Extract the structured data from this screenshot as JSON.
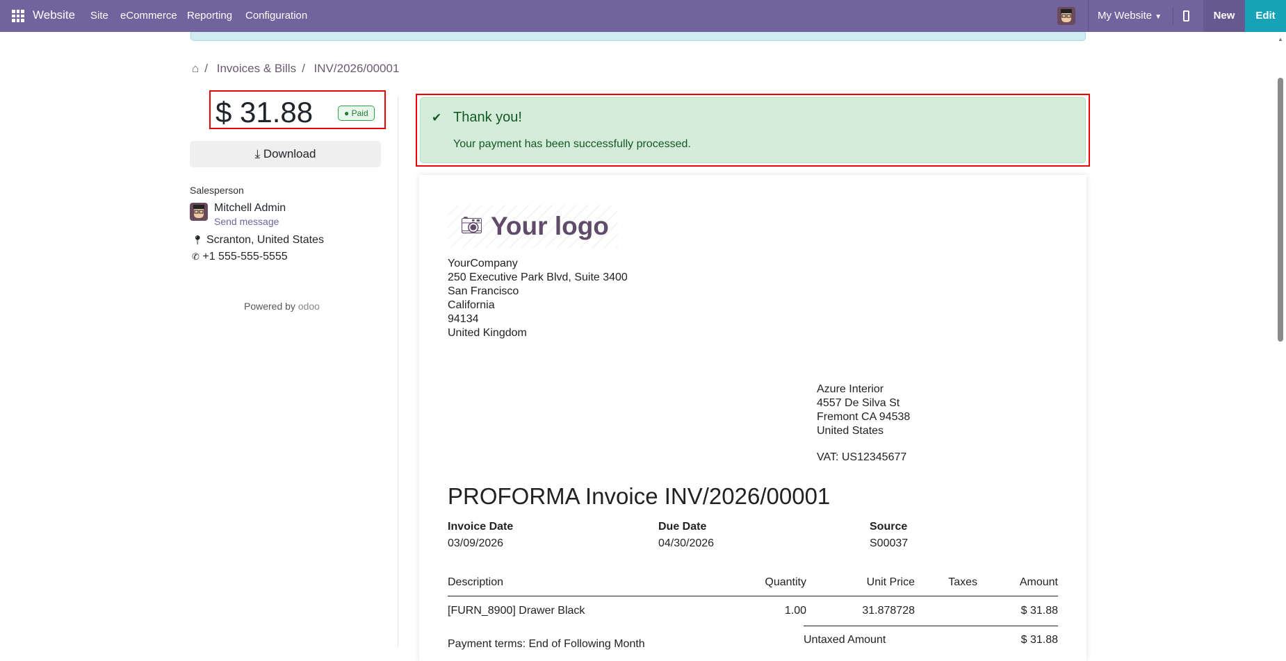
{
  "navbar": {
    "app": "Website",
    "menu": [
      "Site",
      "eCommerce",
      "Reporting",
      "Configuration"
    ],
    "website_selector": "My Website",
    "new_label": "New",
    "edit_label": "Edit",
    "colors": {
      "bg": "#71639e",
      "edit": "#17a2b8"
    }
  },
  "breadcrumb": [
    "Invoices & Bills",
    "INV/2026/00001"
  ],
  "summary": {
    "amount": "$ 31.88",
    "status": "Paid",
    "download_label": "Download"
  },
  "salesperson": {
    "heading": "Salesperson",
    "name": "Mitchell Admin",
    "send_message": "Send message",
    "location": "Scranton, United States",
    "phone": "+1 555-555-5555"
  },
  "powered_by": {
    "text": "Powered by",
    "brand": "odoo"
  },
  "alert": {
    "title": "Thank you!",
    "message": "Your payment has been successfully processed."
  },
  "invoice": {
    "logo_text": "Your logo",
    "company": [
      "YourCompany",
      "250 Executive Park Blvd, Suite 3400",
      "San Francisco",
      "California",
      "94134",
      "United Kingdom"
    ],
    "partner": [
      "Azure Interior",
      "4557 De Silva St",
      "Fremont CA 94538",
      "United States"
    ],
    "vat": "VAT: US12345677",
    "title": "PROFORMA Invoice INV/2026/00001",
    "info": [
      {
        "label": "Invoice Date",
        "value": "03/09/2026"
      },
      {
        "label": "Due Date",
        "value": "04/30/2026"
      },
      {
        "label": "Source",
        "value": "S00037"
      }
    ],
    "columns": [
      "Description",
      "Quantity",
      "Unit Price",
      "Taxes",
      "Amount"
    ],
    "lines": [
      {
        "description": "[FURN_8900] Drawer Black",
        "quantity": "1.00",
        "unit_price": "31.878728",
        "taxes": "",
        "amount": "$ 31.88"
      }
    ],
    "untaxed_label": "Untaxed Amount",
    "untaxed_value": "$ 31.88",
    "payment_terms": "Payment terms: End of Following Month"
  }
}
